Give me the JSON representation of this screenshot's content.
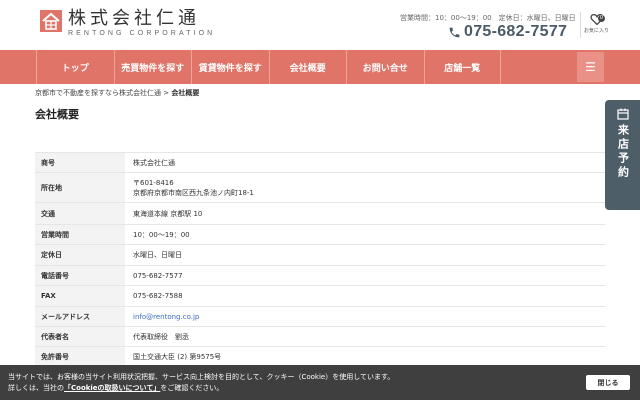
{
  "header": {
    "company_name": "株式会社仁通",
    "company_sub": "RENTONG CORPORATION",
    "hours": "営業時間：10：00～19：00　定休日：水曜日、日曜日",
    "phone": "075-682-7577",
    "favorites_count": "0",
    "favorites_label": "お気に入り",
    "accent_color": "#e07468"
  },
  "nav": {
    "items": [
      "トップ",
      "売買物件を探す",
      "賃貸物件を探す",
      "会社概要",
      "お問い合せ",
      "店舗一覧"
    ],
    "menu_icon": "hamburger-icon"
  },
  "side_tab": {
    "label": "来店予約",
    "icon": "calendar-icon"
  },
  "breadcrumb": {
    "home": "京都市で不動産を探すなら株式会社仁通",
    "separator": ">",
    "current": "会社概要"
  },
  "page_title": "会社概要",
  "company_table": [
    {
      "label": "商号",
      "lines": [
        "株式会社仁通"
      ]
    },
    {
      "label": "所在地",
      "lines": [
        "〒601-8416",
        "京都府京都市南区西九条池ノ内町18-1"
      ]
    },
    {
      "label": "交通",
      "lines": [
        "東海道本線 京都駅 10"
      ]
    },
    {
      "label": "営業時間",
      "lines": [
        "10：00～19：00"
      ]
    },
    {
      "label": "定休日",
      "lines": [
        "水曜日、日曜日"
      ]
    },
    {
      "label": "電話番号",
      "lines": [
        "075-682-7577"
      ]
    },
    {
      "label": "FAX",
      "lines": [
        "075-682-7588"
      ]
    },
    {
      "label": "メールアドレス",
      "lines": [
        "info@rentong.co.jp"
      ]
    },
    {
      "label": "代表者名",
      "lines": [
        "代表取締役　劉丞"
      ]
    },
    {
      "label": "免許番号",
      "lines": [
        "国土交通大臣 (2) 第9575号"
      ]
    }
  ],
  "cookie_banner": {
    "line1": "当サイトでは、お客様の当サイト利用状況把握、サービス向上検討を目的として、クッキー（Cookie）を使用しています。",
    "line2_prefix": "詳しくは、当社の",
    "line2_link": "「Cookieの取扱いについて」",
    "line2_suffix": "をご確認ください。",
    "close_label": "閉じる"
  }
}
